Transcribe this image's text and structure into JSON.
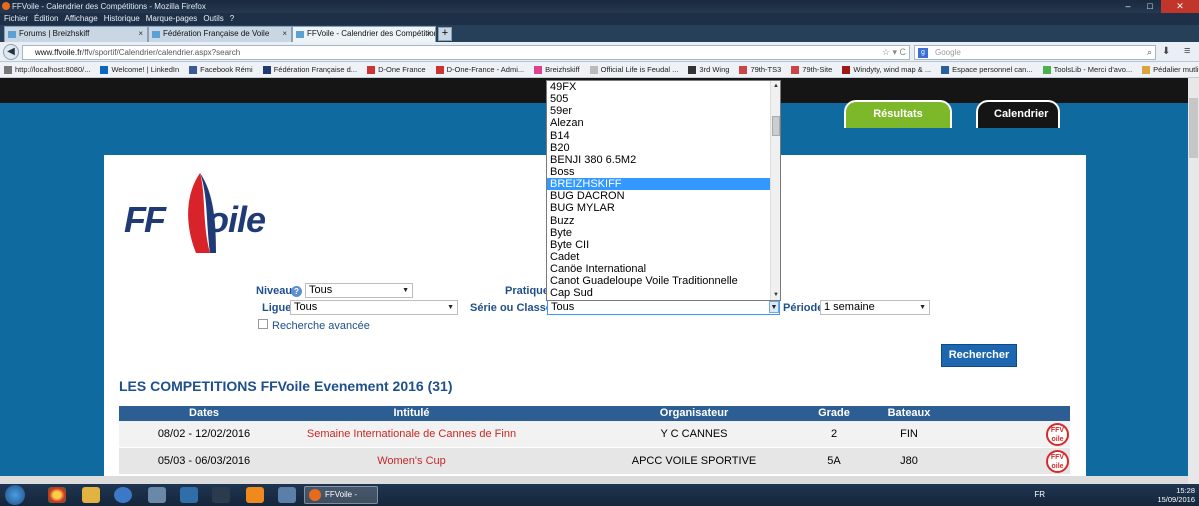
{
  "window": {
    "title": "FFVoile - Calendrier des Compétitions - Mozilla Firefox",
    "controls": [
      "–",
      "□",
      "✕"
    ]
  },
  "menu": [
    "Fichier",
    "Édition",
    "Affichage",
    "Historique",
    "Marque-pages",
    "Outils",
    "?"
  ],
  "tabs": [
    {
      "label": "Forums | Breizhskiff"
    },
    {
      "label": "Fédération Française de Voile"
    },
    {
      "label": "FFVoile - Calendrier des Compétitions"
    }
  ],
  "nav": {
    "url_host": "www.ffvoile.fr",
    "url_path": "/ffv/sportif/Calendrier/calendrier.aspx?search",
    "search_placeholder": "Google"
  },
  "bookmarks": [
    "http://localhost:8080/...",
    "Welcome! | LinkedIn",
    "Facebook Rémi",
    "Fédération Française d...",
    "D-One France",
    "D-One-France - Admi...",
    "Breizhskiff",
    "Official Life is Feudal ...",
    "3rd Wing",
    "79th-TS3",
    "79th-Site",
    "Windyty, wind map & ...",
    "Espace personnel can...",
    "ToolsLib - Merci d'avo...",
    "Pédalier mutli effets Li..."
  ],
  "site_nav": {
    "resultats": "Résultats",
    "calendrier": "Calendrier"
  },
  "logo": {
    "ff": "FF",
    "oile": "oile"
  },
  "filters": {
    "niveau_label": "Niveau",
    "niveau_value": "Tous",
    "pratique_label": "Pratique",
    "ligue_label": "Ligue",
    "ligue_value": "Tous",
    "serie_label": "Série ou Classe",
    "serie_value": "Tous",
    "periode_label": "Période",
    "periode_value": "1 semaine",
    "advanced_label": "Recherche avancée",
    "search_button": "Rechercher"
  },
  "dropdown": {
    "items": [
      "49FX",
      "505",
      "59er",
      "Alezan",
      "B14",
      "B20",
      "BENJI 380 6.5M2",
      "Boss",
      "BREIZHSKIFF",
      "BUG DACRON",
      "BUG MYLAR",
      "Buzz",
      "Byte",
      "Byte CII",
      "Cadet",
      "Canöe International",
      "Canot Guadeloupe Voile Traditionnelle",
      "Cap Sud"
    ],
    "selected": "BREIZHSKIFF"
  },
  "competitions": {
    "title": "LES COMPETITIONS FFVoile Evenement 2016 (31)",
    "columns": [
      "Dates",
      "Intitulé",
      "Organisateur",
      "Grade",
      "Bateaux"
    ],
    "rows": [
      {
        "dates": "08/02 - 12/02/2016",
        "intitule": "Semaine Internationale de Cannes de Finn",
        "organisateur": "Y C CANNES",
        "grade": "2",
        "bateaux": "FIN"
      },
      {
        "dates": "05/03 - 06/03/2016",
        "intitule": "Women's Cup",
        "organisateur": "APCC VOILE SPORTIVE",
        "grade": "5A",
        "bateaux": "J80"
      }
    ],
    "badge": {
      "line1": "FFV",
      "line2": "oile"
    }
  },
  "taskbar": {
    "firefox_label": "FFVoile - Cal...",
    "lang": "FR",
    "time": "15:28",
    "date": "15/09/2016"
  }
}
